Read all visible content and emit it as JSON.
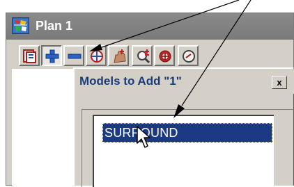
{
  "window": {
    "title": "Plan 1"
  },
  "toolbar": {
    "buttons": [
      {
        "name": "list-models-button",
        "icon": "list-icon",
        "pressed": false
      },
      {
        "name": "add-model-button",
        "icon": "plus-icon",
        "pressed": true
      },
      {
        "name": "remove-model-button",
        "icon": "minus-icon",
        "pressed": false
      },
      {
        "name": "zoom-fit-button",
        "icon": "target-zoom-icon",
        "pressed": false
      },
      {
        "name": "pan-button",
        "icon": "hand-pan-icon",
        "pressed": false
      },
      {
        "name": "zoom-in-out-button",
        "icon": "zoom-plus-minus-icon",
        "pressed": false
      },
      {
        "name": "zoom-center-button",
        "icon": "zoom-center-icon",
        "pressed": false
      },
      {
        "name": "rotate-button",
        "icon": "rotate-icon",
        "pressed": false
      }
    ]
  },
  "dialog": {
    "title": "Models to Add \"1\"",
    "close_label": "x",
    "items": [
      {
        "label": "SURROUND",
        "selected": true
      }
    ]
  },
  "colors": {
    "title_bar": "#7a7a7a",
    "dialog_title_text": "#1a3d7a",
    "selection": "#1c3a84",
    "face": "#d4d0c8"
  }
}
